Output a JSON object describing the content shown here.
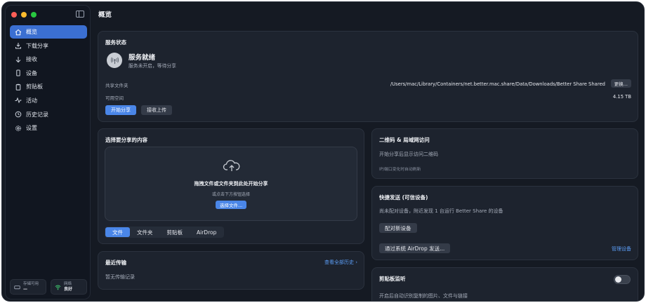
{
  "sidebar": {
    "items": [
      {
        "label": "概览",
        "icon": "home-icon",
        "active": true
      },
      {
        "label": "下载分享",
        "icon": "download-share-icon"
      },
      {
        "label": "接收",
        "icon": "arrow-down-icon"
      },
      {
        "label": "设备",
        "icon": "phone-icon"
      },
      {
        "label": "剪贴板",
        "icon": "clipboard-icon"
      },
      {
        "label": "活动",
        "icon": "activity-icon"
      },
      {
        "label": "历史记录",
        "icon": "history-icon"
      },
      {
        "label": "设置",
        "icon": "gear-icon"
      }
    ],
    "status": {
      "storage_label": "存储可用",
      "storage_value": "—",
      "network_label": "网络",
      "network_value": "良好"
    }
  },
  "header": {
    "title": "概览"
  },
  "service": {
    "title": "服务状态",
    "state": "服务就绪",
    "substate": "服务未开启，等待分享",
    "folder_label": "共享文件夹",
    "folder_path": "/Users/mac/Library/Containers/net.better.mac.share/Data/Downloads/Better Share Shared",
    "change_label": "更换...",
    "space_label": "可用空间",
    "space_value": "4.15 TB",
    "start_label": "开始分享",
    "receive_label": "接收上传"
  },
  "share": {
    "title": "选择要分享的内容",
    "drop_title": "拖拽文件或文件夹到此处开始分享",
    "drop_hint": "或点击下方按钮选择",
    "choose_label": "选择文件...",
    "tabs": [
      "文件",
      "文件夹",
      "剪贴板",
      "AirDrop"
    ]
  },
  "recent": {
    "title": "最近传输",
    "view_all": "查看全部历史 ›",
    "empty": "暂无传输记录"
  },
  "qr": {
    "title": "二维码 & 局域网访问",
    "desc": "开始分享后显示访问二维码",
    "note": "IP/端口变化时自动刷新"
  },
  "quick": {
    "title": "快捷发送 (可信设备)",
    "desc": "尚未配对设备，附近发现 1 台运行 Better Share 的设备",
    "pair_label": "配对新设备",
    "airdrop_label": "通过系统 AirDrop 发送...",
    "manage_label": "管理设备"
  },
  "clipboard": {
    "title": "剪贴板监听",
    "desc": "开启后自动识别复制的图片、文件与链接",
    "enabled": false
  },
  "colors": {
    "accent": "#4a86e8",
    "active_nav": "#3b6fd1",
    "link": "#5b9cf5",
    "window_bg": "#151a23",
    "card_bg": "#1d232e"
  }
}
